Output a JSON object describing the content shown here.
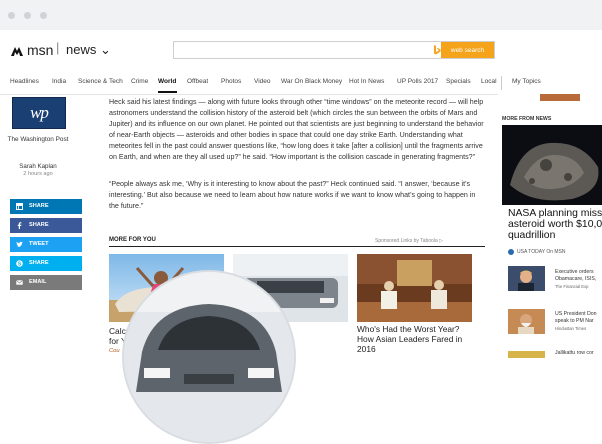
{
  "header": {
    "brand": "msn",
    "section": "news ⌄",
    "search_placeholder": "",
    "search_button": "web search"
  },
  "nav": [
    "Headlines",
    "India",
    "Science & Tech",
    "Crime",
    "World",
    "Offbeat",
    "Photos",
    "Video",
    "War On Black Money",
    "Hot In News",
    "UP Polls 2017",
    "Specials",
    "Local",
    "My Topics"
  ],
  "publisher": {
    "logo_text": "wp",
    "name": "The Washington Post",
    "author": "Sarah Kaplan",
    "time": "2 hours ago"
  },
  "share": {
    "linkedin": "SHARE",
    "facebook": "SHARE",
    "twitter": "TWEET",
    "skype": "SHARE",
    "email": "EMAIL"
  },
  "article": {
    "p1": "Heck said his latest findings — along with future looks through other “time windows” on the meteorite record — will help astronomers understand the collision history of the asteroid belt (which circles the sun between the orbits of Mars and Jupiter) and its influence on our own planet. He pointed out that scientists are just beginning to understand the behavior of near-Earth objects — asteroids and other bodies in space that could one day strike Earth. Understanding what meteorites fell in the past could answer questions like, “how long does it take [after a collision] until the fragments arrive on Earth, and when are they all used up?” he said. “How important is the collision cascade in generating fragments?”",
    "p2": "“People always ask me, ‘Why is it interesting to know about the past?” Heck continued said. “I answer, ‘because it’s interesting.’ But also because we need to learn about how nature works if we want to know what’s going to happen in the future.”"
  },
  "more_for_you": {
    "title": "MORE FOR YOU",
    "sponsored": "Sponsored Links by Taboola ▷",
    "cards": [
      {
        "title_l1": "Calcul",
        "title_l2": "for Y",
        "source": "Cou"
      },
      {
        "title_l1": "Who's Had the Worst Year?",
        "title_l2": "How Asian Leaders Fared in",
        "title_l3": "2016"
      }
    ]
  },
  "side": {
    "section": "MORE FROM NEWS",
    "headline_l1": "NASA planning missio",
    "headline_l2": "asteroid worth $10,00",
    "headline_l3": "quadrillion",
    "source": "USA TODAY On MSN",
    "items": [
      {
        "l1": "Executive orders",
        "l2": "Obamacare, ISIS,",
        "src": "The Financial Exp"
      },
      {
        "l1": "US President Don",
        "l2": "speak to PM Nar",
        "src": "Hindustan Times"
      },
      {
        "l1": "Jallikattu row cor",
        "l2": "",
        "src": ""
      }
    ]
  }
}
